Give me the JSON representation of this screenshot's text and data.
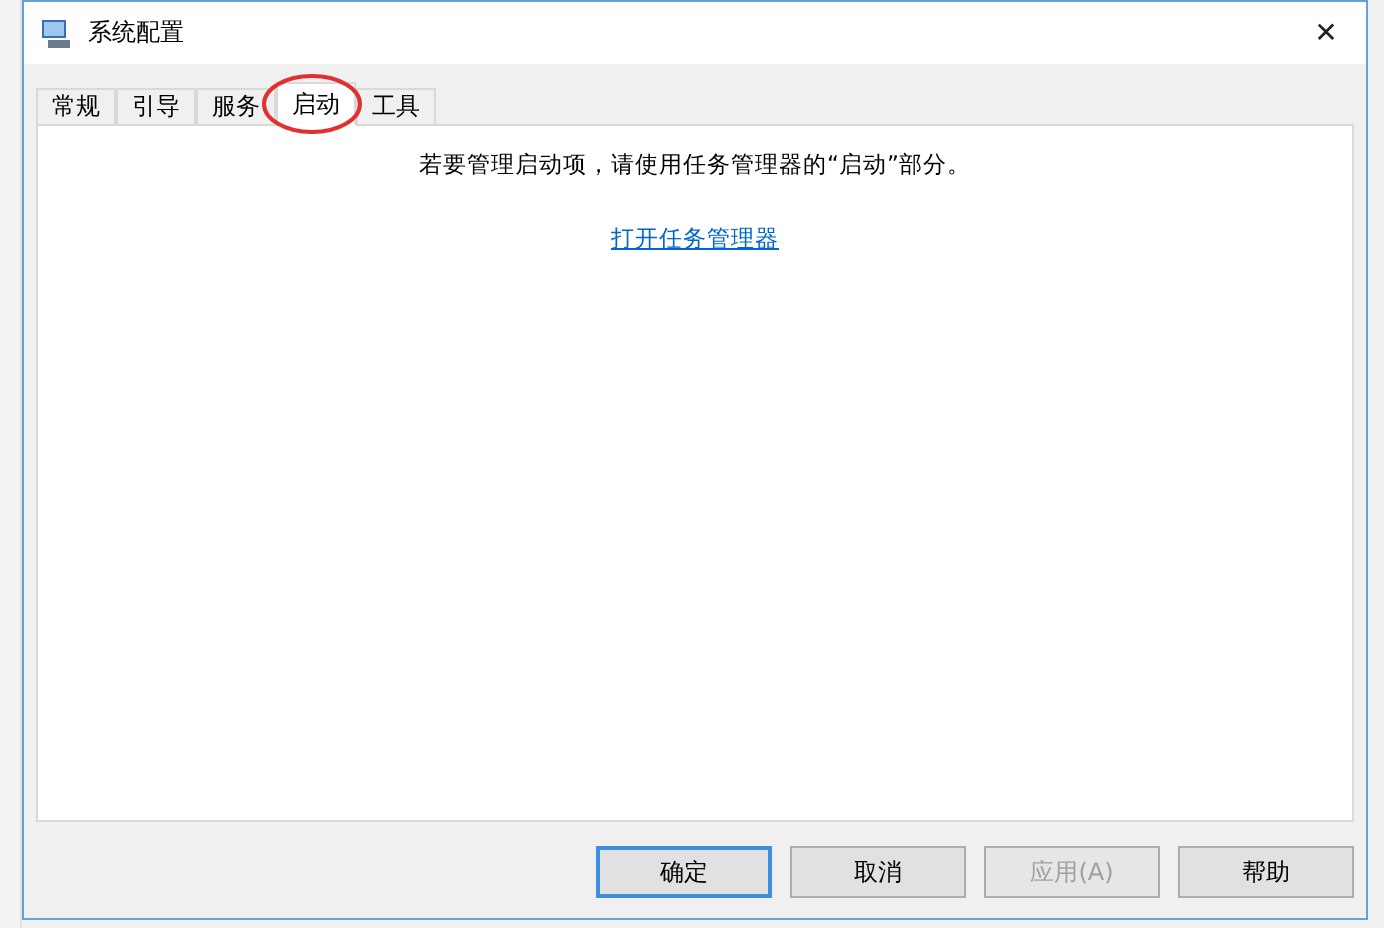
{
  "window": {
    "title": "系统配置",
    "close": "✕"
  },
  "tabs": [
    {
      "label": "常规",
      "selected": false
    },
    {
      "label": "引导",
      "selected": false
    },
    {
      "label": "服务",
      "selected": false
    },
    {
      "label": "启动",
      "selected": true,
      "circled": true
    },
    {
      "label": "工具",
      "selected": false
    }
  ],
  "message": "若要管理启动项，请使用任务管理器的“启动”部分。",
  "link": "打开任务管理器",
  "buttons": [
    {
      "label": "确定",
      "default": true,
      "disabled": false
    },
    {
      "label": "取消",
      "default": false,
      "disabled": false
    },
    {
      "label": "应用(A)",
      "default": false,
      "disabled": true
    },
    {
      "label": "帮助",
      "default": false,
      "disabled": false
    }
  ]
}
